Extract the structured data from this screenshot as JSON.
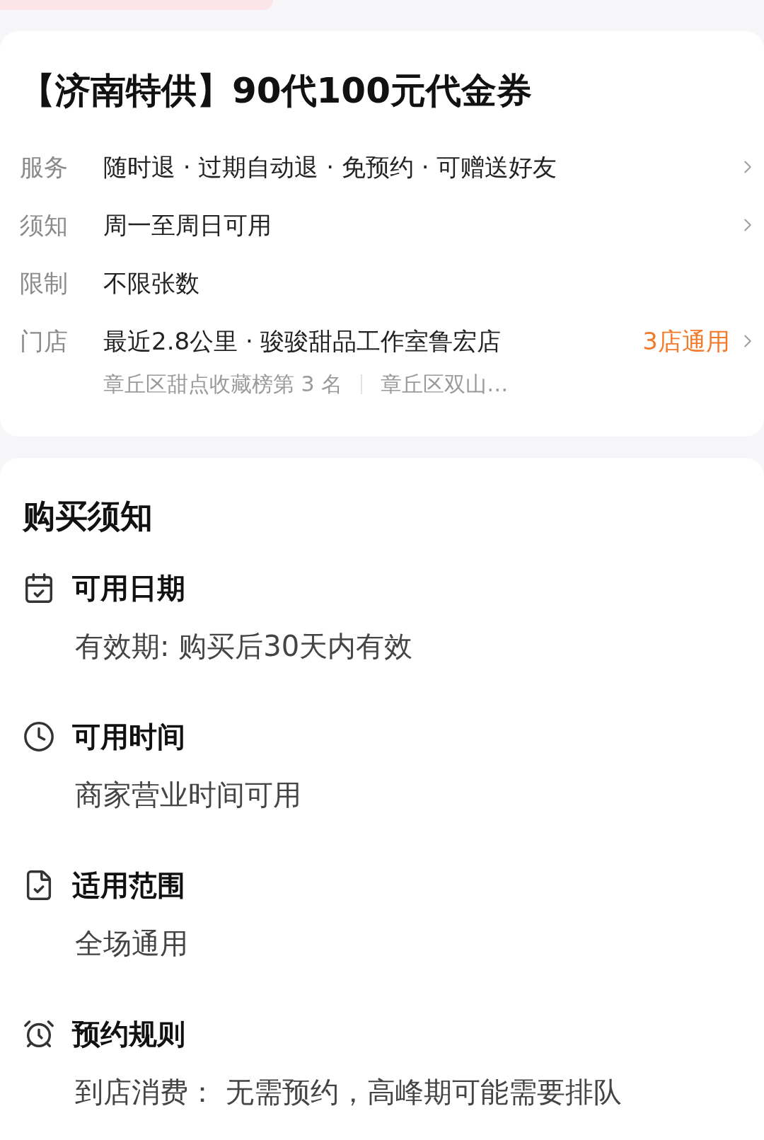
{
  "title": "【济南特供】90代100元代金券",
  "info_rows": [
    {
      "label": "服务",
      "value": "随时退 · 过期自动退 · 免预约 · 可赠送好友",
      "has_arrow": true
    },
    {
      "label": "须知",
      "value": "周一至周日可用",
      "has_arrow": true
    },
    {
      "label": "限制",
      "value": "不限张数",
      "has_arrow": false
    }
  ],
  "store": {
    "label": "门店",
    "value": "最近2.8公里 · 骏骏甜品工作室鲁宏店",
    "tag": "3店通用",
    "has_arrow": true,
    "details": [
      "章丘区甜点收藏榜第 3 名",
      "章丘区双山…"
    ]
  },
  "notice": {
    "heading": "购买须知",
    "sections": [
      {
        "title": "可用日期",
        "text": "有效期: 购买后30天内有效"
      },
      {
        "title": "可用时间",
        "text": "商家营业时间可用"
      },
      {
        "title": "适用范围",
        "text": "全场通用"
      },
      {
        "title": "预约规则",
        "text": "到店消费： 无需预约，高峰期可能需要排队"
      }
    ]
  }
}
